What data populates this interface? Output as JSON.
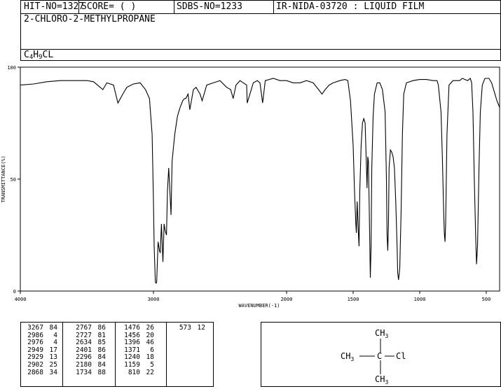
{
  "header": {
    "hit_no": "HIT-NO=1327",
    "score": "SCORE=  (   )",
    "sdbs_no": "SDBS-NO=1233",
    "ir_nida": "IR-NIDA-03720 : LIQUID FILM"
  },
  "compound": {
    "name": "2-CHLORO-2-METHYLPROPANE",
    "formula_c": "C",
    "formula_c_sub": "4",
    "formula_h": "H",
    "formula_h_sub": "9",
    "formula_cl": "CL"
  },
  "chart_data": {
    "type": "line",
    "xlabel": "WAVENUMBER(-1)",
    "ylabel": "TRANSMITTANCE(%)",
    "xlim": [
      4000,
      400
    ],
    "ylim": [
      0,
      100
    ],
    "x_ticks": [
      4000,
      3000,
      2000,
      1500,
      1000,
      500
    ],
    "y_ticks": [
      0,
      50,
      100
    ],
    "series": [
      {
        "points": [
          [
            4000,
            92
          ],
          [
            3900,
            92.5
          ],
          [
            3800,
            93.5
          ],
          [
            3700,
            94
          ],
          [
            3600,
            94
          ],
          [
            3500,
            94
          ],
          [
            3450,
            93.5
          ],
          [
            3400,
            91
          ],
          [
            3380,
            90
          ],
          [
            3350,
            93
          ],
          [
            3300,
            92
          ],
          [
            3267,
            84
          ],
          [
            3230,
            88
          ],
          [
            3200,
            91
          ],
          [
            3150,
            92.5
          ],
          [
            3100,
            93
          ],
          [
            3060,
            90
          ],
          [
            3030,
            86
          ],
          [
            3010,
            70
          ],
          [
            3000,
            40
          ],
          [
            2995,
            20
          ],
          [
            2986,
            4
          ],
          [
            2980,
            3.5
          ],
          [
            2976,
            4
          ],
          [
            2965,
            22
          ],
          [
            2955,
            18
          ],
          [
            2949,
            17
          ],
          [
            2940,
            30
          ],
          [
            2929,
            13
          ],
          [
            2920,
            30
          ],
          [
            2912,
            27
          ],
          [
            2902,
            25
          ],
          [
            2895,
            45
          ],
          [
            2885,
            55
          ],
          [
            2868,
            34
          ],
          [
            2860,
            58
          ],
          [
            2840,
            70
          ],
          [
            2820,
            78
          ],
          [
            2800,
            82
          ],
          [
            2780,
            85
          ],
          [
            2767,
            86
          ],
          [
            2757,
            86
          ],
          [
            2740,
            88
          ],
          [
            2727,
            81
          ],
          [
            2700,
            90
          ],
          [
            2680,
            91
          ],
          [
            2650,
            88
          ],
          [
            2634,
            85
          ],
          [
            2600,
            92
          ],
          [
            2550,
            93
          ],
          [
            2500,
            94
          ],
          [
            2450,
            91
          ],
          [
            2420,
            90
          ],
          [
            2401,
            86
          ],
          [
            2380,
            92
          ],
          [
            2350,
            94
          ],
          [
            2300,
            92
          ],
          [
            2296,
            84
          ],
          [
            2250,
            93
          ],
          [
            2220,
            94
          ],
          [
            2200,
            93
          ],
          [
            2180,
            84
          ],
          [
            2160,
            94
          ],
          [
            2100,
            95
          ],
          [
            2050,
            94
          ],
          [
            2000,
            94
          ],
          [
            1950,
            93
          ],
          [
            1900,
            93
          ],
          [
            1850,
            94
          ],
          [
            1800,
            93
          ],
          [
            1760,
            90
          ],
          [
            1734,
            88
          ],
          [
            1710,
            90
          ],
          [
            1680,
            92
          ],
          [
            1650,
            93
          ],
          [
            1600,
            94
          ],
          [
            1560,
            94.5
          ],
          [
            1540,
            94
          ],
          [
            1520,
            85
          ],
          [
            1500,
            65
          ],
          [
            1490,
            45
          ],
          [
            1480,
            30
          ],
          [
            1476,
            26
          ],
          [
            1470,
            40
          ],
          [
            1460,
            25
          ],
          [
            1456,
            20
          ],
          [
            1450,
            45
          ],
          [
            1440,
            65
          ],
          [
            1430,
            75
          ],
          [
            1420,
            77
          ],
          [
            1410,
            75
          ],
          [
            1400,
            55
          ],
          [
            1396,
            46
          ],
          [
            1390,
            60
          ],
          [
            1385,
            58
          ],
          [
            1380,
            40
          ],
          [
            1371,
            6
          ],
          [
            1365,
            20
          ],
          [
            1360,
            55
          ],
          [
            1350,
            78
          ],
          [
            1340,
            88
          ],
          [
            1320,
            93
          ],
          [
            1300,
            93
          ],
          [
            1280,
            90
          ],
          [
            1260,
            80
          ],
          [
            1250,
            50
          ],
          [
            1245,
            25
          ],
          [
            1240,
            18
          ],
          [
            1235,
            30
          ],
          [
            1230,
            55
          ],
          [
            1220,
            63
          ],
          [
            1210,
            62
          ],
          [
            1200,
            60
          ],
          [
            1190,
            55
          ],
          [
            1180,
            40
          ],
          [
            1170,
            20
          ],
          [
            1165,
            8
          ],
          [
            1159,
            5
          ],
          [
            1150,
            10
          ],
          [
            1140,
            35
          ],
          [
            1130,
            70
          ],
          [
            1120,
            88
          ],
          [
            1100,
            93
          ],
          [
            1050,
            94
          ],
          [
            1000,
            94.5
          ],
          [
            950,
            94.5
          ],
          [
            900,
            94
          ],
          [
            870,
            94
          ],
          [
            860,
            92
          ],
          [
            840,
            80
          ],
          [
            830,
            60
          ],
          [
            820,
            35
          ],
          [
            815,
            26
          ],
          [
            810,
            22
          ],
          [
            805,
            30
          ],
          [
            795,
            70
          ],
          [
            780,
            92
          ],
          [
            750,
            94
          ],
          [
            700,
            94
          ],
          [
            680,
            95
          ],
          [
            640,
            94
          ],
          [
            620,
            95
          ],
          [
            610,
            93
          ],
          [
            600,
            80
          ],
          [
            590,
            50
          ],
          [
            580,
            25
          ],
          [
            573,
            12
          ],
          [
            566,
            20
          ],
          [
            555,
            55
          ],
          [
            545,
            80
          ],
          [
            530,
            92
          ],
          [
            510,
            95
          ],
          [
            480,
            95
          ],
          [
            460,
            93
          ],
          [
            440,
            89
          ],
          [
            420,
            85
          ],
          [
            400,
            82
          ]
        ]
      }
    ]
  },
  "peaks": [
    [
      "3267",
      "84"
    ],
    [
      "2986",
      "4"
    ],
    [
      "2976",
      "4"
    ],
    [
      "2949",
      "17"
    ],
    [
      "2929",
      "13"
    ],
    [
      "2902",
      "25"
    ],
    [
      "2868",
      "34"
    ],
    [
      "2767",
      "86"
    ],
    [
      "2727",
      "81"
    ],
    [
      "2634",
      "85"
    ],
    [
      "2401",
      "86"
    ],
    [
      "2296",
      "84"
    ],
    [
      "2180",
      "84"
    ],
    [
      "1734",
      "88"
    ],
    [
      "1476",
      "26"
    ],
    [
      "1456",
      "20"
    ],
    [
      "1396",
      "46"
    ],
    [
      "1371",
      "6"
    ],
    [
      "1240",
      "18"
    ],
    [
      "1159",
      "5"
    ],
    [
      "810",
      "22"
    ],
    [
      "573",
      "12"
    ]
  ],
  "structure": {
    "top_group": "CH",
    "top_sub": "3",
    "left_group": "CH",
    "left_sub": "3",
    "center": "C",
    "right_group": "Cl",
    "bottom_group": "CH",
    "bottom_sub": "3"
  }
}
